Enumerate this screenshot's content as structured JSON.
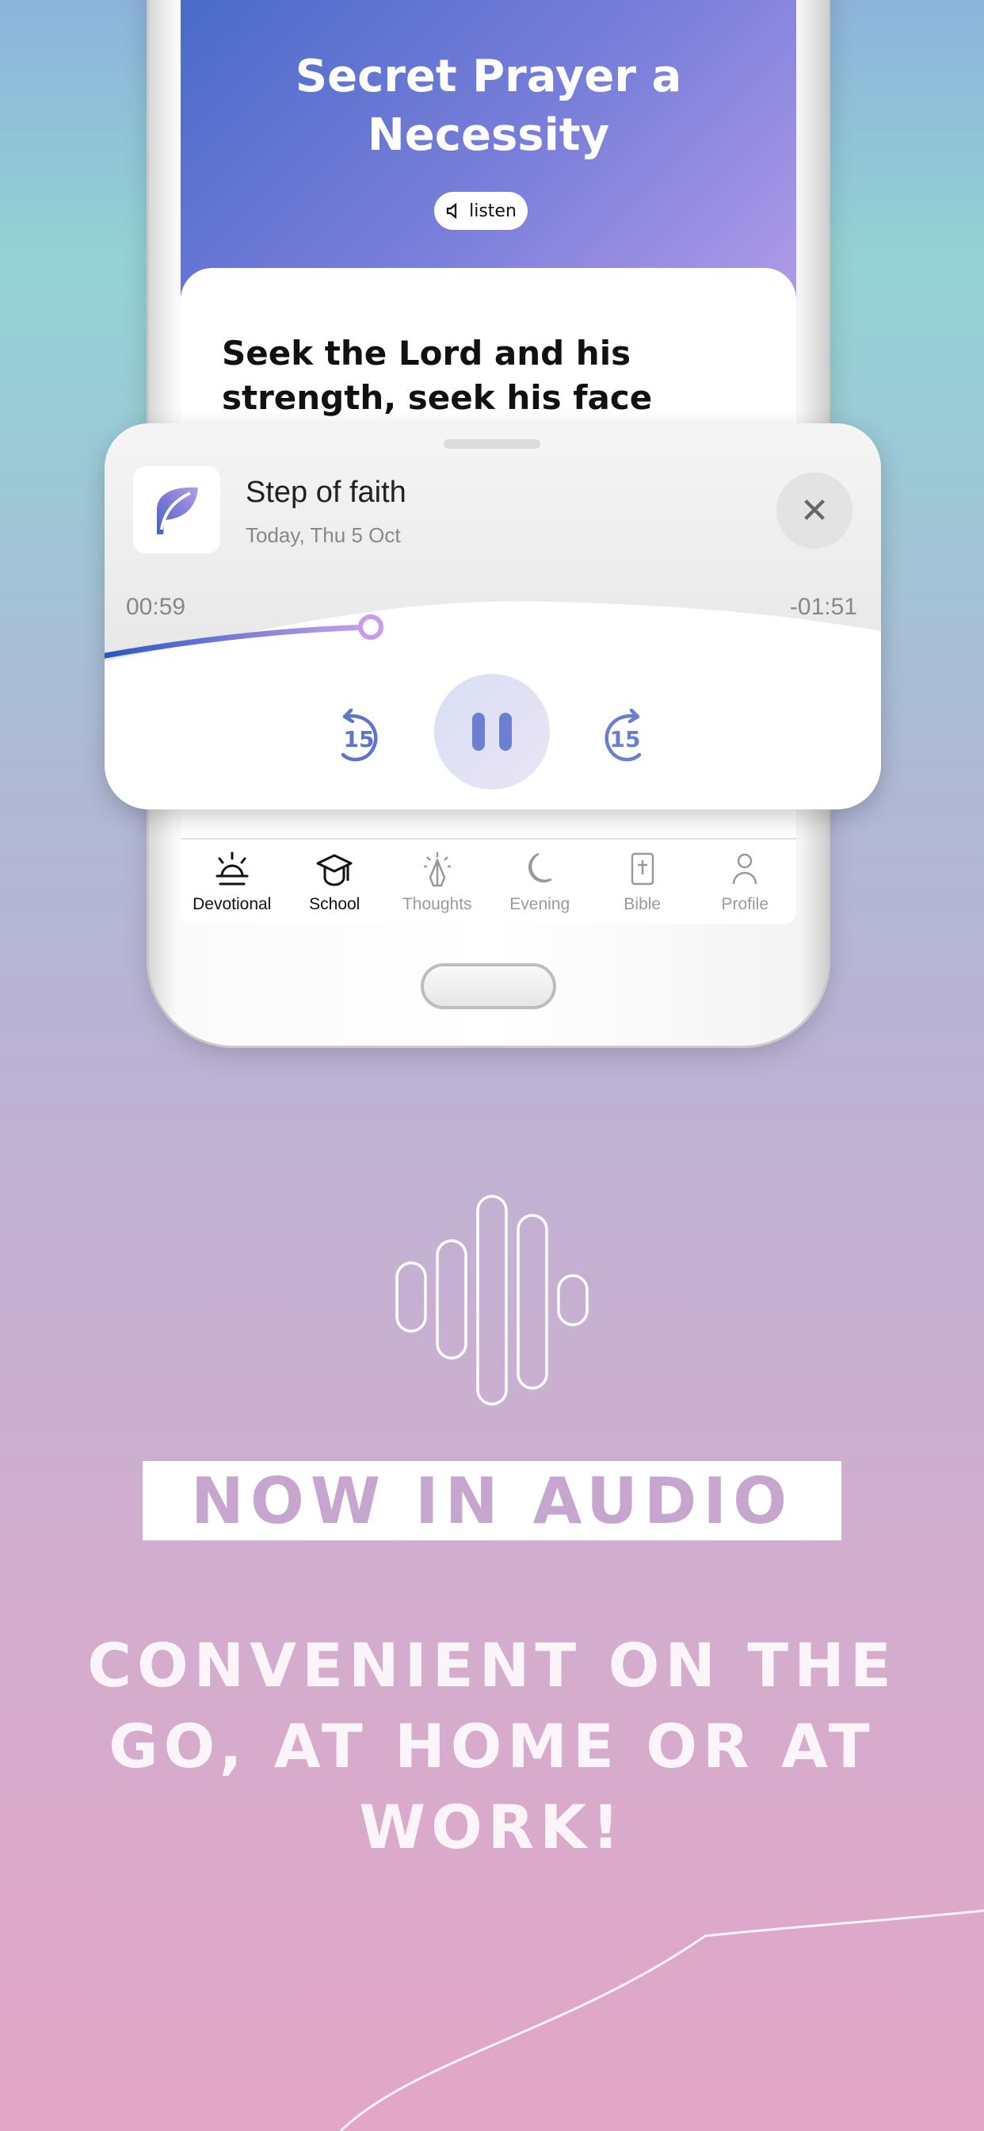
{
  "screen": {
    "title": "Secret Prayer a Necessity",
    "listen_label": "listen",
    "verse": "Seek the Lord and his strength, seek his face"
  },
  "player": {
    "title": "Step of faith",
    "date": "Today, Thu 5 Oct",
    "elapsed": "00:59",
    "remaining": "-01:51",
    "progress_percent": 35,
    "skip_back_seconds": "15",
    "skip_forward_seconds": "15",
    "state": "playing",
    "accent": "#6d7fd0"
  },
  "tabs": [
    {
      "label": "Devotional",
      "icon": "sunrise-icon",
      "active": true
    },
    {
      "label": "School",
      "icon": "graduation-cap-icon",
      "active": true
    },
    {
      "label": "Thoughts",
      "icon": "praying-hands-icon",
      "active": false
    },
    {
      "label": "Evening",
      "icon": "moon-icon",
      "active": false
    },
    {
      "label": "Bible",
      "icon": "bible-icon",
      "active": false
    },
    {
      "label": "Profile",
      "icon": "person-icon",
      "active": false
    }
  ],
  "promo": {
    "badge": "NOW IN AUDIO",
    "headline": "CONVENIENT ON THE GO, AT HOME OR AT WORK!"
  }
}
